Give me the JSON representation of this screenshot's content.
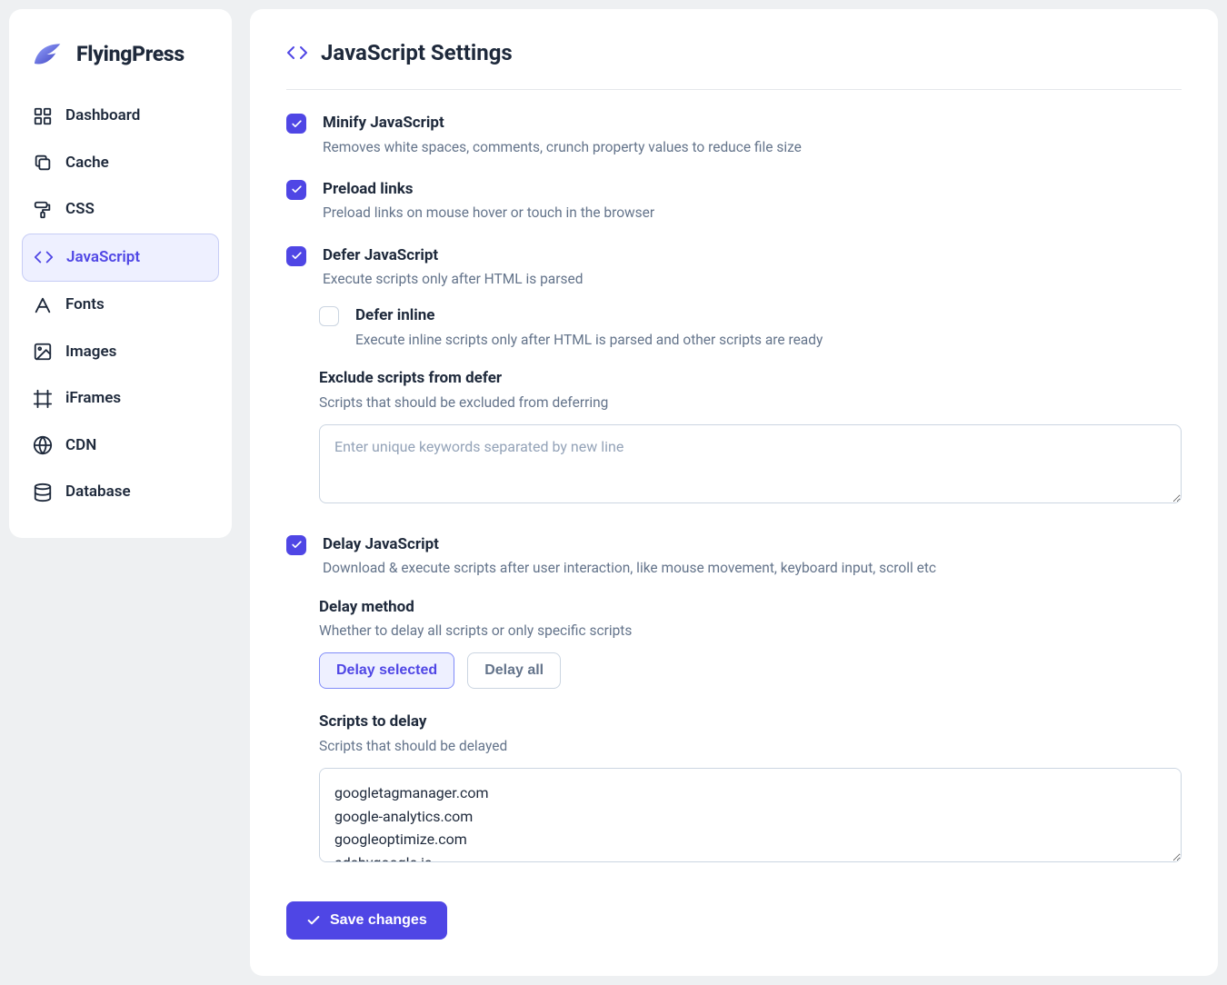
{
  "brand": {
    "name": "FlyingPress"
  },
  "sidebar": {
    "items": [
      {
        "label": "Dashboard"
      },
      {
        "label": "Cache"
      },
      {
        "label": "CSS"
      },
      {
        "label": "JavaScript"
      },
      {
        "label": "Fonts"
      },
      {
        "label": "Images"
      },
      {
        "label": "iFrames"
      },
      {
        "label": "CDN"
      },
      {
        "label": "Database"
      }
    ],
    "active_index": 3
  },
  "page": {
    "title": "JavaScript Settings"
  },
  "options": {
    "minify": {
      "title": "Minify JavaScript",
      "desc": "Removes white spaces, comments, crunch property values to reduce file size",
      "checked": true
    },
    "preload": {
      "title": "Preload links",
      "desc": "Preload links on mouse hover or touch in the browser",
      "checked": true
    },
    "defer": {
      "title": "Defer JavaScript",
      "desc": "Execute scripts only after HTML is parsed",
      "checked": true
    },
    "defer_inline": {
      "title": "Defer inline",
      "desc": "Execute inline scripts only after HTML is parsed and other scripts are ready",
      "checked": false
    },
    "exclude_defer": {
      "title": "Exclude scripts from defer",
      "desc": "Scripts that should be excluded from deferring",
      "placeholder": "Enter unique keywords separated by new line",
      "value": ""
    },
    "delay": {
      "title": "Delay JavaScript",
      "desc": "Download & execute scripts after user interaction, like mouse movement, keyboard input, scroll etc",
      "checked": true
    },
    "delay_method": {
      "title": "Delay method",
      "desc": "Whether to delay all scripts or only specific scripts",
      "options": [
        "Delay selected",
        "Delay all"
      ],
      "selected_index": 0
    },
    "scripts_to_delay": {
      "title": "Scripts to delay",
      "desc": "Scripts that should be delayed",
      "value": "googletagmanager.com\ngoogle-analytics.com\ngoogleoptimize.com\nadsbygoogle.js"
    }
  },
  "actions": {
    "save": "Save changes"
  }
}
